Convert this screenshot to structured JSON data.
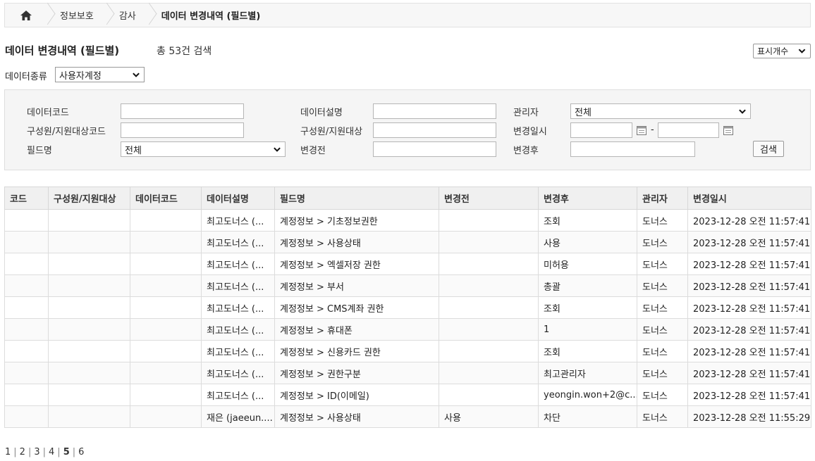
{
  "breadcrumb": {
    "items": [
      "정보보호",
      "감사",
      "데이터 변경내역 (필드별)"
    ]
  },
  "header": {
    "title": "데이터 변경내역 (필드별)",
    "result_count": "총 53건 검색",
    "display_count_label": "표시개수"
  },
  "data_type": {
    "label": "데이터종류",
    "selected": "사용자계정"
  },
  "search": {
    "data_code_label": "데이터코드",
    "data_desc_label": "데이터설명",
    "manager_label": "관리자",
    "manager_selected": "전체",
    "member_code_label": "구성원/지원대상코드",
    "member_label": "구성원/지원대상",
    "change_date_label": "변경일시",
    "date_separator": "-",
    "field_name_label": "필드명",
    "field_name_selected": "전체",
    "before_label": "변경전",
    "after_label": "변경후",
    "search_button": "검색"
  },
  "table": {
    "columns": [
      "코드",
      "구성원/지원대상",
      "데이터코드",
      "데이터설명",
      "필드명",
      "변경전",
      "변경후",
      "관리자",
      "변경일시"
    ],
    "rows": [
      [
        "",
        "",
        "",
        "최고도너스 (...",
        "계정정보 > 기초정보권한",
        "",
        "조회",
        "도너스",
        "2023-12-28 오전 11:57:41"
      ],
      [
        "",
        "",
        "",
        "최고도너스 (...",
        "계정정보 > 사용상태",
        "",
        "사용",
        "도너스",
        "2023-12-28 오전 11:57:41"
      ],
      [
        "",
        "",
        "",
        "최고도너스 (...",
        "계정정보 > 엑셀저장 권한",
        "",
        "미허용",
        "도너스",
        "2023-12-28 오전 11:57:41"
      ],
      [
        "",
        "",
        "",
        "최고도너스 (...",
        "계정정보 > 부서",
        "",
        "총괄",
        "도너스",
        "2023-12-28 오전 11:57:41"
      ],
      [
        "",
        "",
        "",
        "최고도너스 (...",
        "계정정보 > CMS계좌 권한",
        "",
        "조회",
        "도너스",
        "2023-12-28 오전 11:57:41"
      ],
      [
        "",
        "",
        "",
        "최고도너스 (...",
        "계정정보 > 휴대폰",
        "",
        "1",
        "도너스",
        "2023-12-28 오전 11:57:41"
      ],
      [
        "",
        "",
        "",
        "최고도너스 (...",
        "계정정보 > 신용카드 권한",
        "",
        "조회",
        "도너스",
        "2023-12-28 오전 11:57:41"
      ],
      [
        "",
        "",
        "",
        "최고도너스 (...",
        "계정정보 > 권한구분",
        "",
        "최고관리자",
        "도너스",
        "2023-12-28 오전 11:57:41"
      ],
      [
        "",
        "",
        "",
        "최고도너스 (...",
        "계정정보 > ID(이메일)",
        "",
        "yeongin.won+2@c...",
        "도너스",
        "2023-12-28 오전 11:57:41"
      ],
      [
        "",
        "",
        "",
        "재은 (jaeeun....",
        "계정정보 > 사용상태",
        "사용",
        "차단",
        "도너스",
        "2023-12-28 오전 11:55:29"
      ]
    ]
  },
  "pagination": {
    "pages": [
      "1",
      "2",
      "3",
      "4",
      "5",
      "6"
    ],
    "current": "5"
  }
}
